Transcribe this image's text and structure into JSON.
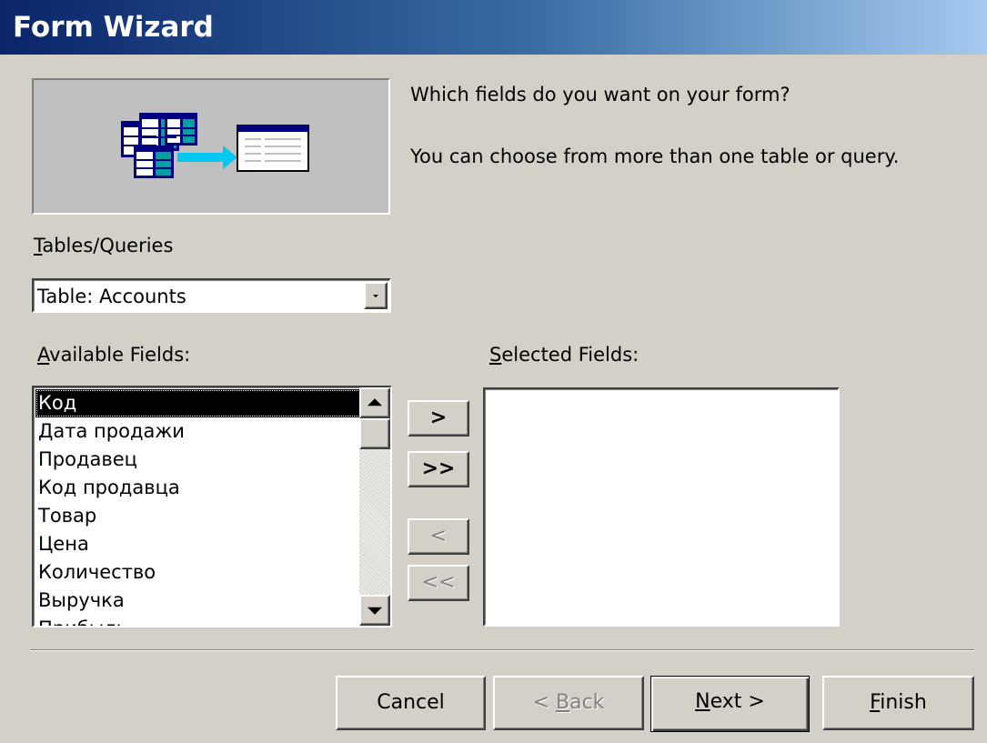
{
  "window": {
    "title": "Form Wizard"
  },
  "prompt": {
    "question": "Which fields do you want on your form?",
    "hint": "You can choose from more than one table or query."
  },
  "tables_queries": {
    "label_hotkey": "T",
    "label_rest": "ables/Queries",
    "selected": "Table: Accounts"
  },
  "available_fields": {
    "label_hotkey": "A",
    "label_rest": "vailable Fields:",
    "items": [
      "Код",
      "Дата продажи",
      "Продавец",
      "Код продавца",
      "Товар",
      "Цена",
      "Количество",
      "Выручка",
      "Прибыль"
    ],
    "selected_index": 0
  },
  "selected_fields": {
    "label_hotkey": "S",
    "label_rest": "elected Fields:",
    "items": []
  },
  "move_buttons": {
    "add_one": ">",
    "add_all": ">>",
    "remove_one": "<",
    "remove_all": "<<"
  },
  "footer": {
    "cancel": "Cancel",
    "back_prefix": "< ",
    "back_hotkey": "B",
    "back_rest": "ack",
    "next_hotkey": "N",
    "next_rest": "ext >",
    "finish_hotkey": "F",
    "finish_rest": "inish"
  },
  "colors": {
    "dialog_bg": "#d4d0c8",
    "title_start": "#0a246a",
    "title_end": "#a6caf0",
    "selection_bg": "#000000",
    "arrow_cyan": "#00c0e0"
  },
  "icons": [
    "tables-illustration-icon",
    "arrow-right-icon",
    "form-illustration-icon",
    "dropdown-arrow-icon",
    "scroll-up-icon",
    "scroll-down-icon"
  ]
}
